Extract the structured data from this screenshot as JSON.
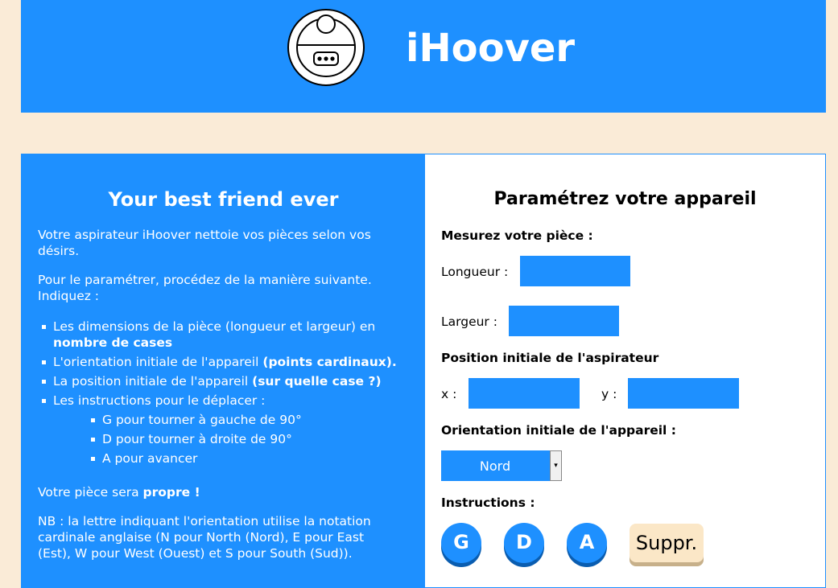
{
  "header": {
    "title": "iHoover",
    "logo_icon": "robot-vacuum-icon"
  },
  "intro": {
    "title": "Your best friend ever",
    "p1": "Votre aspirateur iHoover nettoie vos pièces selon vos désirs.",
    "p2": "Pour le paramétrer, procédez de la manière suivante. Indiquez :",
    "items": [
      {
        "text": "Les dimensions de la pièce (longueur et largeur) en ",
        "bold": "nombre de cases"
      },
      {
        "text": "L'orientation initiale de l'appareil ",
        "bold": "(points cardinaux)."
      },
      {
        "text": "La position initiale de l'appareil ",
        "bold": "(sur quelle case ?)"
      },
      {
        "text": "Les instructions pour le déplacer :",
        "bold": ""
      }
    ],
    "sub_items": [
      "G pour tourner à gauche de 90°",
      "D pour tourner à droite de 90°",
      "A pour avancer"
    ],
    "result_text": "Votre pièce sera ",
    "result_bold": "propre !",
    "nb": "NB : la lettre indiquant l'orientation utilise la notation cardinale anglaise (N pour North (Nord), E pour East (Est), W pour West (Ouest) et S pour South (Sud))."
  },
  "form": {
    "title": "Paramétrez votre appareil",
    "room_heading": "Mesurez votre pièce :",
    "length_label": "Longueur :",
    "length_value": "",
    "width_label": "Largeur :",
    "width_value": "",
    "position_heading": "Position initiale de l'aspirateur",
    "x_label": "x :",
    "x_value": "",
    "y_label": "y :",
    "y_value": "",
    "orientation_heading": "Orientation initiale de l'appareil :",
    "orientation_value": "Nord",
    "instructions_heading": "Instructions :",
    "buttons": {
      "g": "G",
      "d": "D",
      "a": "A",
      "suppr": "Suppr."
    }
  }
}
